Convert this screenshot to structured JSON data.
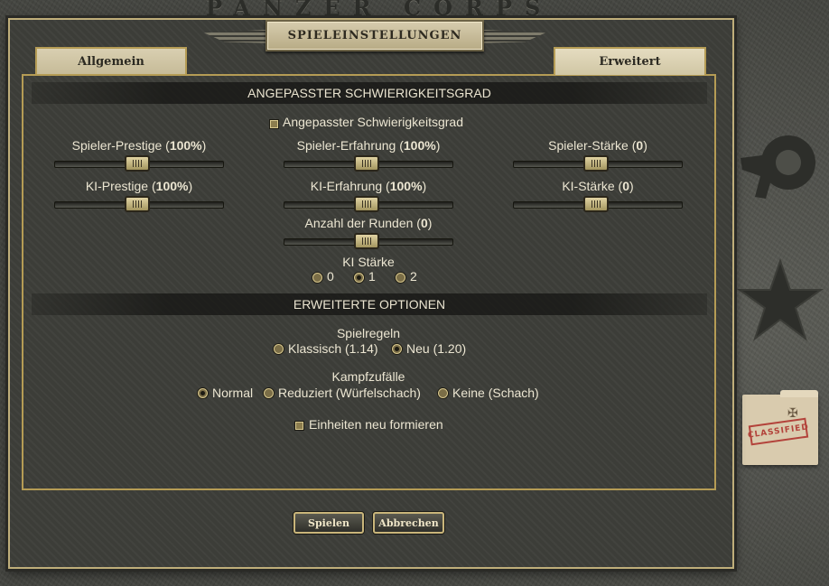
{
  "app_title": "PANZER CORPS",
  "dialog": {
    "title": "SPIELEINSTELLUNGEN",
    "tabs": [
      {
        "label": "Allgemein",
        "active": false
      },
      {
        "label": "Erweitert",
        "active": true
      }
    ]
  },
  "difficulty": {
    "header": "ANGEPASSTER SCHWIERIGKEITSGRAD",
    "custom_checkbox_label": "Angepasster Schwierigkeitsgrad",
    "sliders": {
      "player_prestige": {
        "label": "Spieler-Prestige (",
        "value": "100%",
        "suffix": ")"
      },
      "player_experience": {
        "label": "Spieler-Erfahrung (",
        "value": "100%",
        "suffix": ")"
      },
      "player_strength": {
        "label": "Spieler-Stärke (",
        "value": "0",
        "suffix": ")"
      },
      "ai_prestige": {
        "label": "KI-Prestige (",
        "value": "100%",
        "suffix": ")"
      },
      "ai_experience": {
        "label": "KI-Erfahrung (",
        "value": "100%",
        "suffix": ")"
      },
      "ai_strength": {
        "label": "KI-Stärke (",
        "value": "0",
        "suffix": ")"
      },
      "turns": {
        "label": "Anzahl der Runden (",
        "value": "0",
        "suffix": ")"
      }
    },
    "ai_level": {
      "label": "KI Stärke",
      "options": [
        "0",
        "1",
        "2"
      ],
      "selected": "1"
    }
  },
  "advanced": {
    "header": "ERWEITERTE OPTIONEN",
    "rules": {
      "label": "Spielregeln",
      "options": [
        "Klassisch (1.14)",
        "Neu (1.20)"
      ],
      "selected": "Neu (1.20)"
    },
    "combat": {
      "label": "Kampfzufälle",
      "options": [
        "Normal",
        "Reduziert (Würfelschach)",
        "Keine (Schach)"
      ],
      "selected": "Normal"
    },
    "reform_checkbox_label": "Einheiten neu formieren"
  },
  "buttons": {
    "play": "Spielen",
    "cancel": "Abbrechen"
  },
  "side": {
    "folder_stamp": "CLASSIFIED"
  },
  "colors": {
    "gold_border": "#b59c55",
    "dialog_bg": "#3e3f3a",
    "text": "#ece6d2"
  }
}
